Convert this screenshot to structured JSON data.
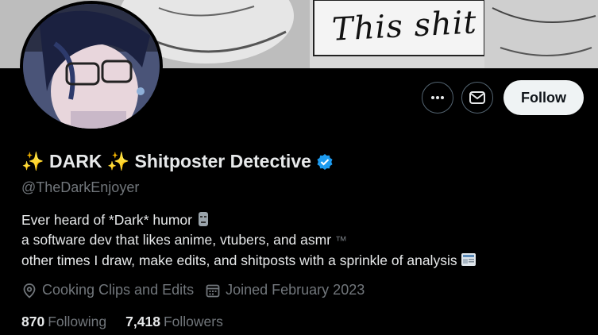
{
  "banner": {
    "caption": "This shit"
  },
  "profile": {
    "display_name_prefix": "✨ DARK ✨",
    "display_name_suffix": "Shitposter Detective",
    "handle": "@TheDarkEnjoyer",
    "verified_color": "#1d9bf0"
  },
  "actions": {
    "more_icon": "more-icon",
    "message_icon": "mail-icon",
    "follow_label": "Follow"
  },
  "bio": {
    "line1": "Ever heard of *Dark* humor",
    "line2": "a software dev that likes anime, vtubers, and asmr",
    "line2_tm": "™",
    "line3": "other times I draw, make edits, and shitposts with a sprinkle of analysis"
  },
  "meta": {
    "location": "Cooking Clips and Edits",
    "joined": "Joined February 2023"
  },
  "stats": {
    "following_count": "870",
    "following_label": "Following",
    "followers_count": "7,418",
    "followers_label": "Followers"
  },
  "colors": {
    "background": "#000000",
    "text": "#e7e9ea",
    "muted": "#71767b",
    "accent": "#1d9bf0"
  }
}
